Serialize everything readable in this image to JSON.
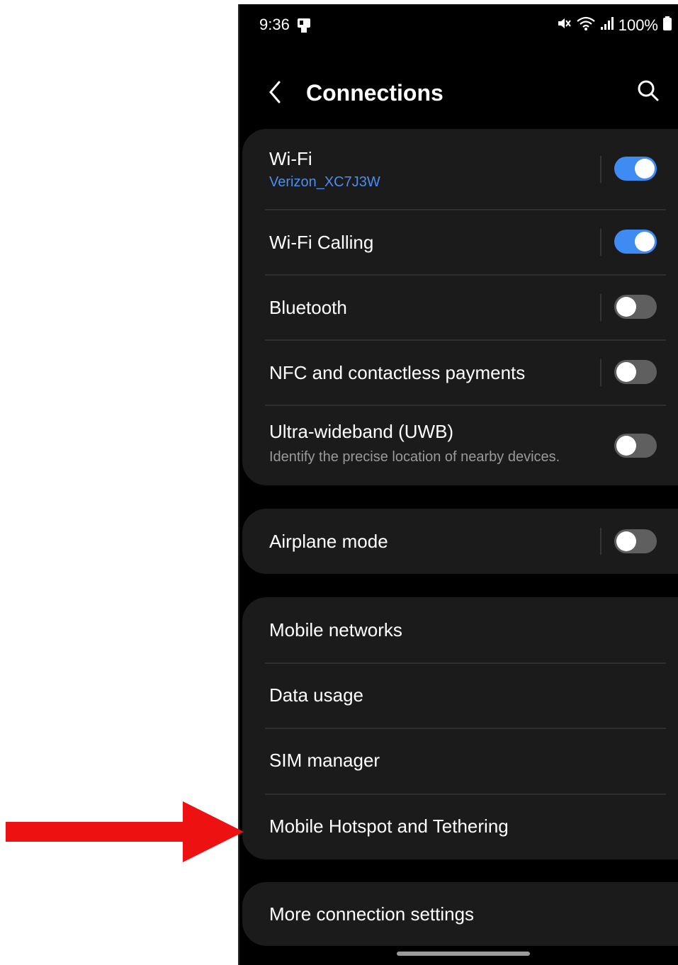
{
  "status_bar": {
    "time": "9:36",
    "battery": "100%"
  },
  "header": {
    "title": "Connections"
  },
  "group1": [
    {
      "title": "Wi-Fi",
      "subtitle": "Verizon_XC7J3W",
      "toggle": true
    },
    {
      "title": "Wi-Fi Calling",
      "toggle": true
    },
    {
      "title": "Bluetooth",
      "toggle": false
    },
    {
      "title": "NFC and contactless payments",
      "toggle": false
    },
    {
      "title": "Ultra-wideband (UWB)",
      "subtitle": "Identify the precise location of nearby devices.",
      "toggle": false
    }
  ],
  "group2": [
    {
      "title": "Airplane mode",
      "toggle": false
    }
  ],
  "group3": [
    {
      "title": "Mobile networks"
    },
    {
      "title": "Data usage"
    },
    {
      "title": "SIM manager"
    },
    {
      "title": "Mobile Hotspot and Tethering"
    }
  ],
  "group4": [
    {
      "title": "More connection settings"
    }
  ],
  "colors": {
    "accent": "#3e8cf3",
    "link": "#4a8ef0",
    "subtext": "#9a9a9a",
    "arrow": "#ee1111"
  },
  "icons": [
    "notification-icon",
    "mute-icon",
    "wifi-icon",
    "signal-icon",
    "battery-icon",
    "back-icon",
    "search-icon",
    "arrow-pointer"
  ]
}
